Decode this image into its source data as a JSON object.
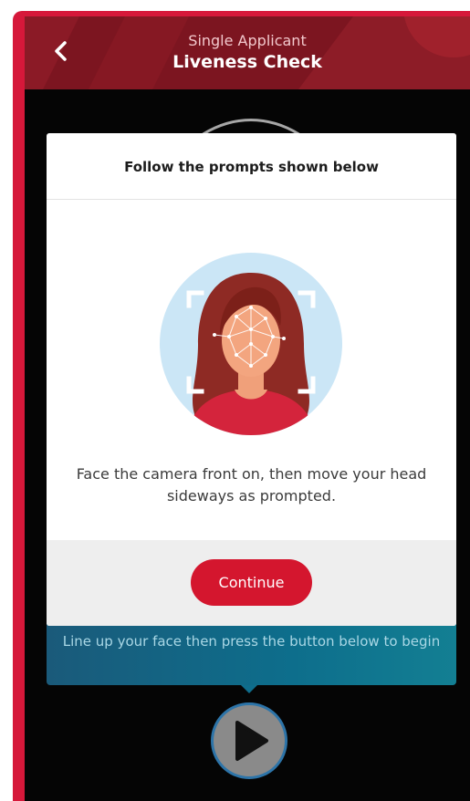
{
  "header": {
    "subtitle": "Single Applicant",
    "title": "Liveness Check",
    "back_icon": "chevron-left-icon"
  },
  "modal": {
    "title": "Follow the prompts shown below",
    "illustration_icon": "face-scan-illustration",
    "body_text": "Face the camera front on, then move your head sideways as prompted.",
    "continue_label": "Continue"
  },
  "banner": {
    "text": "Line up your face then press the button below to begin"
  },
  "play_button": {
    "icon": "play-icon"
  },
  "colors": {
    "brand_red": "#d4162e",
    "header_bg": "#7c1520",
    "banner_teal": "#0d6e8c"
  }
}
